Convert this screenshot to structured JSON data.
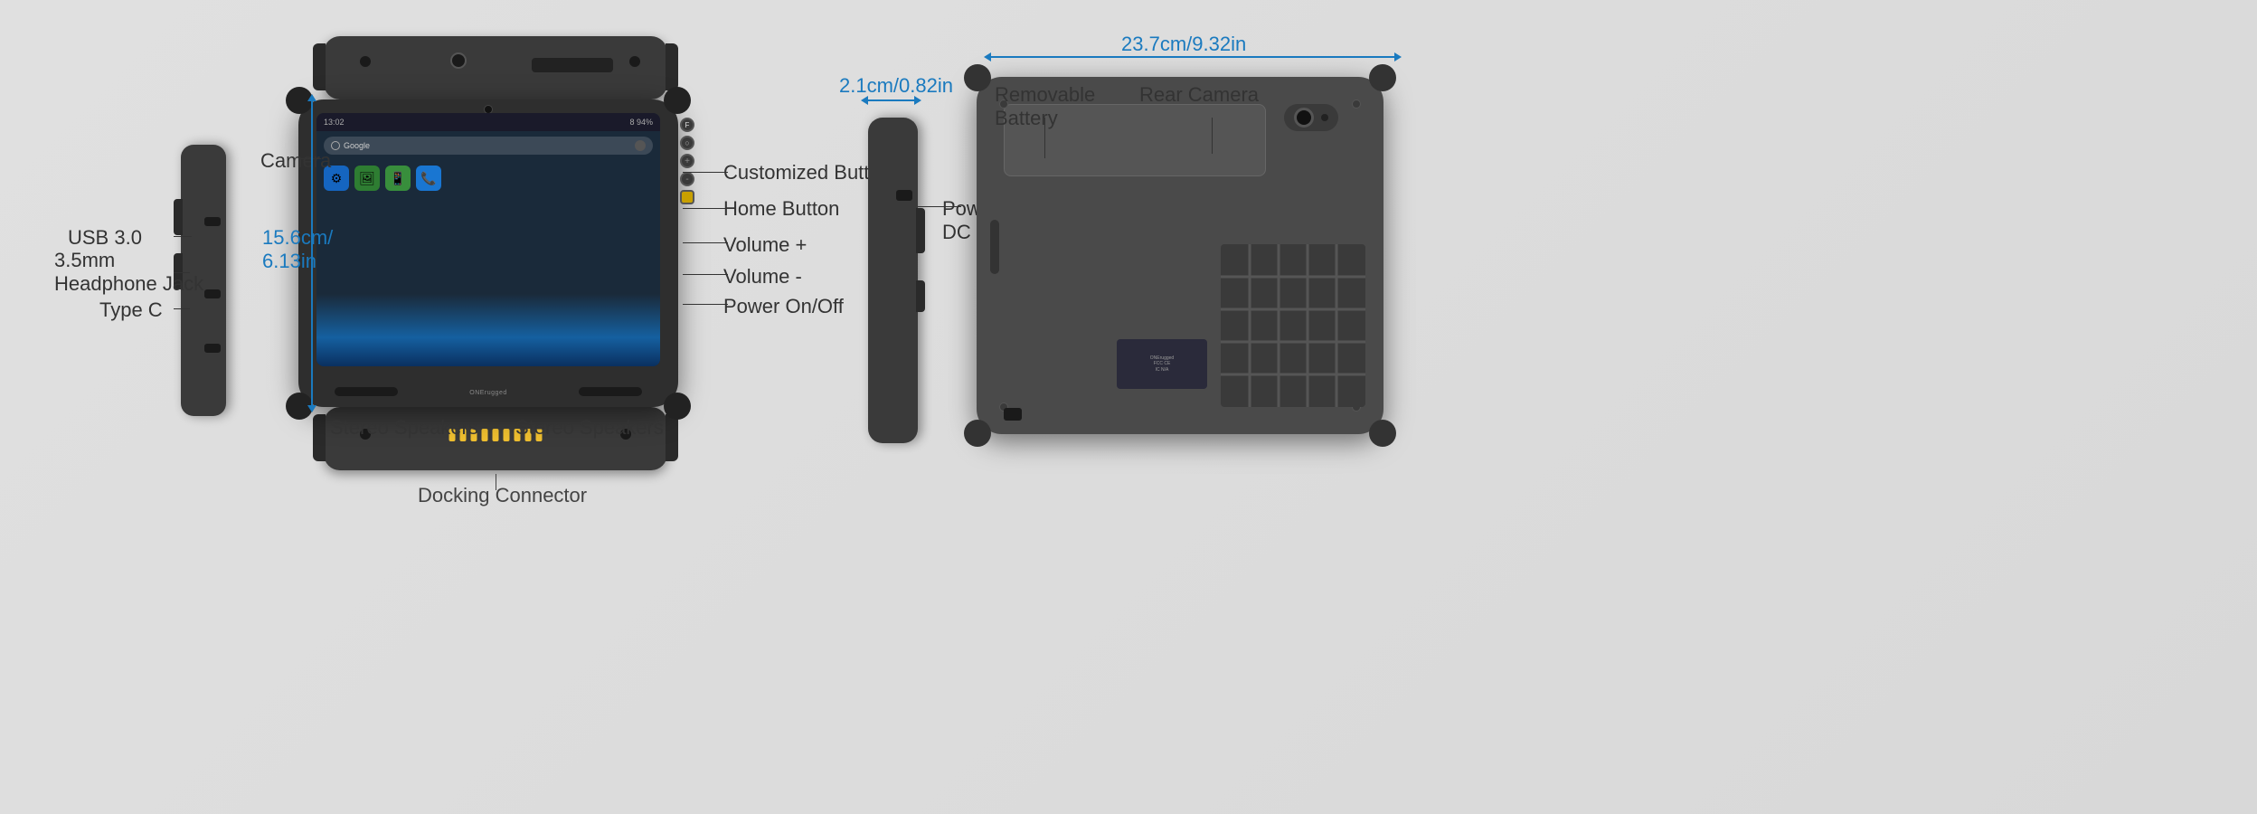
{
  "background_color": "#e0e0e0",
  "labels": {
    "camera": "Camera",
    "usb3": "USB 3.0",
    "headphone": "3.5mm\nHeadphone Jack",
    "typeC": "Type C",
    "stereo_speakers_left": "Stereo Speakers",
    "stereo_speakers_right": "Stereo Speakers",
    "docking_connector": "Docking Connector",
    "customized_button": "Customized Button",
    "home_button": "Home Button",
    "volume_plus": "Volume +",
    "volume_minus": "Volume -",
    "power_onoff": "Power On/Off",
    "power_dc_jack": "Power\nDC Jack",
    "removable_battery": "Removable\nBattery",
    "rear_camera": "Rear Camera",
    "dim_height": "15.6cm/\n6.13in",
    "dim_width": "23.7cm/9.32in",
    "dim_depth": "2.1cm/0.82in",
    "brand": "ONErugged"
  }
}
